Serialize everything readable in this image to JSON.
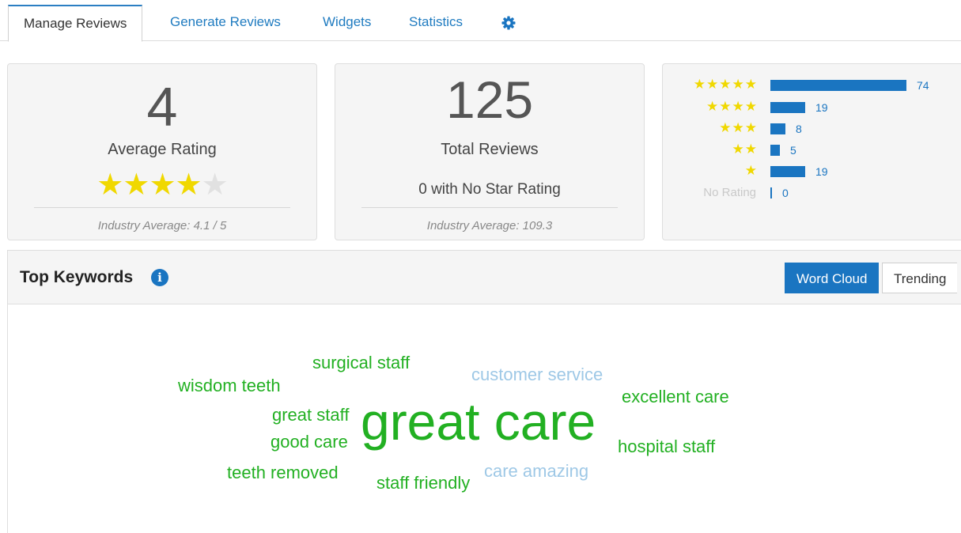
{
  "tabs": [
    {
      "label": "Manage Reviews",
      "active": true
    },
    {
      "label": "Generate Reviews",
      "active": false
    },
    {
      "label": "Widgets",
      "active": false
    },
    {
      "label": "Statistics",
      "active": false
    }
  ],
  "settings_icon": "gear-icon",
  "average_card": {
    "value": "4",
    "label": "Average Rating",
    "stars_filled": 4,
    "stars_total": 5,
    "footer": "Industry Average: 4.1 / 5"
  },
  "total_card": {
    "value": "125",
    "label": "Total Reviews",
    "sub": "0 with No Star Rating",
    "footer": "Industry Average: 109.3"
  },
  "distribution": [
    {
      "stars": "★★★★★",
      "count": 74
    },
    {
      "stars": "★★★★",
      "count": 19
    },
    {
      "stars": "★★★",
      "count": 8
    },
    {
      "stars": "★★",
      "count": 5
    },
    {
      "stars": "★",
      "count": 19
    },
    {
      "stars": "No Rating",
      "count": 0
    }
  ],
  "keywords": {
    "title": "Top Keywords",
    "info_icon": "info-icon",
    "buttons": {
      "word_cloud": "Word Cloud",
      "trending": "Trending"
    },
    "words": [
      {
        "text": "surgical staff",
        "tone": "green"
      },
      {
        "text": "customer service",
        "tone": "muted"
      },
      {
        "text": "wisdom teeth",
        "tone": "green"
      },
      {
        "text": "excellent care",
        "tone": "green"
      },
      {
        "text": "great staff",
        "tone": "green"
      },
      {
        "text": "great care",
        "tone": "green"
      },
      {
        "text": "good care",
        "tone": "green"
      },
      {
        "text": "hospital staff",
        "tone": "green"
      },
      {
        "text": "teeth removed",
        "tone": "green"
      },
      {
        "text": "staff friendly",
        "tone": "green"
      },
      {
        "text": "care amazing",
        "tone": "muted"
      }
    ]
  },
  "colors": {
    "accent": "#1a75c1",
    "star": "#f0d800",
    "keyword": "#22b022",
    "keyword_muted": "#9ec8e6"
  }
}
